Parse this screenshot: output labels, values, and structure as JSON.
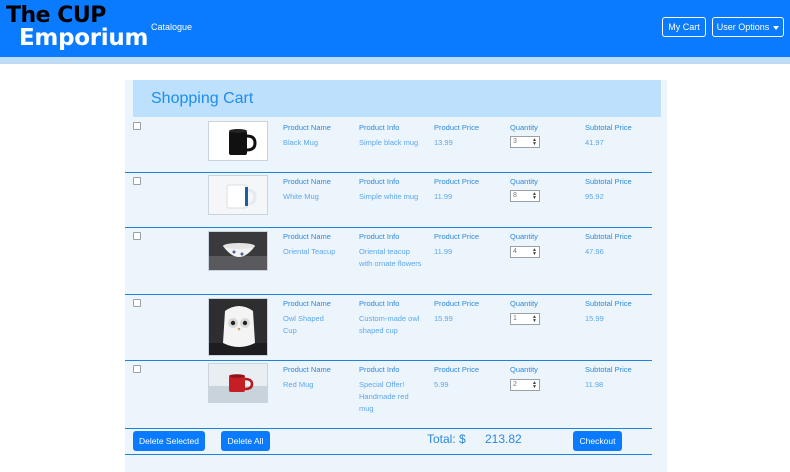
{
  "brand": {
    "line1": "The CUP",
    "line2": "Emporium"
  },
  "nav": {
    "catalogue": "Catalogue",
    "my_cart": "My Cart",
    "user_options": "User Options"
  },
  "cart": {
    "title": "Shopping Cart",
    "headers": {
      "name": "Product Name",
      "info": "Product Info",
      "price": "Product Price",
      "quantity": "Quantity",
      "subtotal": "Subtotal Price"
    },
    "items": [
      {
        "name": "Black Mug",
        "info": "Simple black mug",
        "price": "13.99",
        "quantity": "3",
        "subtotal": "41.97",
        "image": "black-mug"
      },
      {
        "name": "White Mug",
        "info": "Simple white mug",
        "price": "11.99",
        "quantity": "8",
        "subtotal": "95.92",
        "image": "white-mug"
      },
      {
        "name": "Oriental Teacup",
        "info": "Oriental teacup with ornate flowers",
        "price": "11.99",
        "quantity": "4",
        "subtotal": "47.96",
        "image": "oriental-teacup"
      },
      {
        "name": "Owl Shaped Cup",
        "info": "Custom-made owl shaped cup",
        "price": "15.99",
        "quantity": "1",
        "subtotal": "15.99",
        "image": "owl-cup"
      },
      {
        "name": "Red Mug",
        "info": "Special Offer! Handmade red mug",
        "price": "5.99",
        "quantity": "2",
        "subtotal": "11.98",
        "image": "red-mug"
      }
    ],
    "footer": {
      "delete_selected": "Delete Selected",
      "delete_all": "Delete All",
      "total_label": "Total: $",
      "total_value": "213.82",
      "checkout": "Checkout"
    }
  },
  "colors": {
    "navbar": "#0a7bff",
    "header_band": "#bde0fc",
    "panel": "#edf5fc",
    "accent_text": "#2c88dc"
  }
}
